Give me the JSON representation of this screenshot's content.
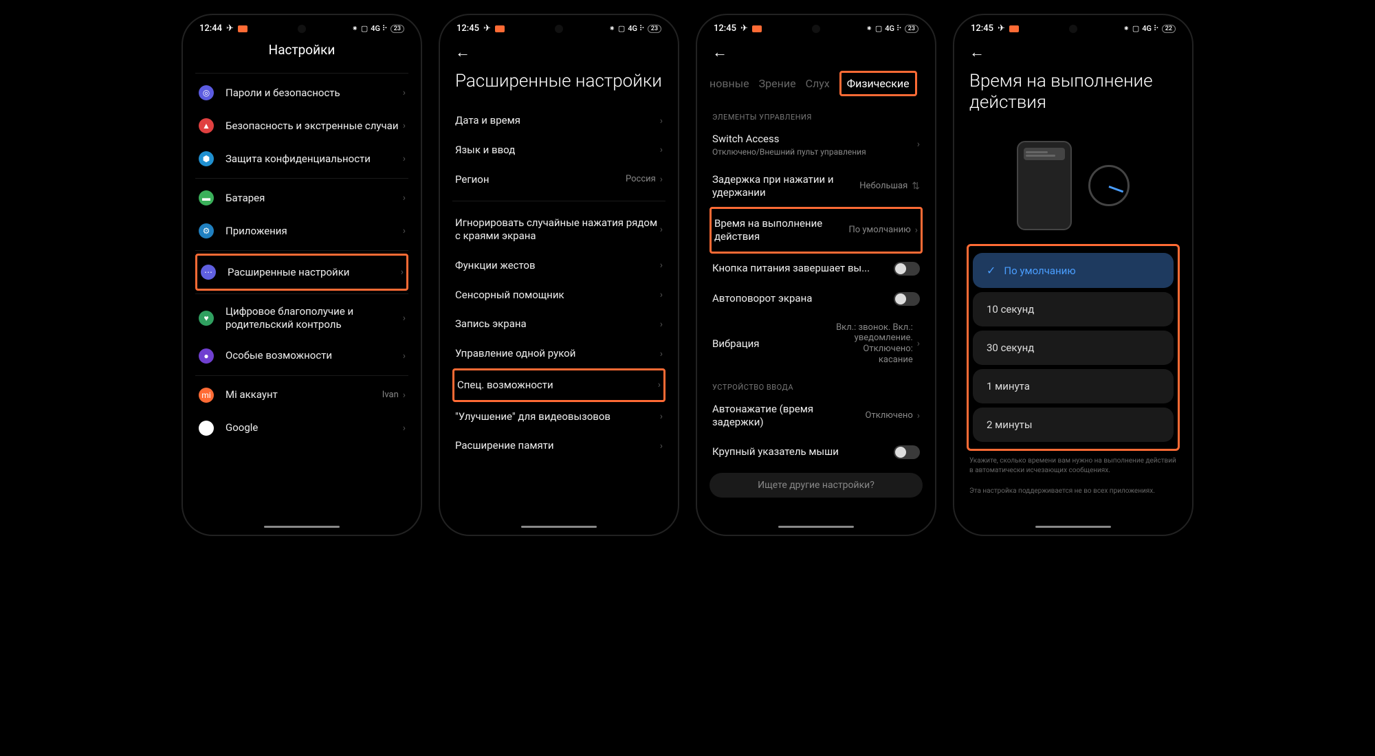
{
  "statusbar": {
    "time1": "12:44",
    "time234": "12:45",
    "battery1": "23",
    "battery234": "23",
    "battery4": "22",
    "icons_right": "⁕ 🔊 4G ⠇⠇"
  },
  "screen1": {
    "title": "Настройки",
    "rows": [
      {
        "icon": "fingerprint",
        "color": "#5b5be0",
        "label": "Пароли и безопасность"
      },
      {
        "icon": "alert",
        "color": "#e04040",
        "label": "Безопасность и экстренные случаи"
      },
      {
        "icon": "shield",
        "color": "#2090d0",
        "label": "Защита конфиденциальности"
      },
      {
        "icon": "battery",
        "color": "#3ab05a",
        "label": "Батарея"
      },
      {
        "icon": "apps",
        "color": "#2080c0",
        "label": "Приложения"
      },
      {
        "icon": "dots",
        "color": "#6060e0",
        "label": "Расширенные настройки",
        "hl": true
      },
      {
        "icon": "wellbeing",
        "color": "#30a060",
        "label": "Цифровое благополучие и родительский контроль"
      },
      {
        "icon": "a11y",
        "color": "#7040d0",
        "label": "Особые возможности"
      },
      {
        "icon": "mi",
        "color": "#ff6b35",
        "label": "Mi аккаунт",
        "value": "Ivan"
      },
      {
        "icon": "google",
        "color": "#fff",
        "label": "Google"
      }
    ]
  },
  "screen2": {
    "title": "Расширенные настройки",
    "rows": [
      {
        "label": "Дата и время"
      },
      {
        "label": "Язык и ввод"
      },
      {
        "label": "Регион",
        "value": "Россия"
      },
      {
        "divider": true
      },
      {
        "label": "Игнорировать случайные нажатия рядом с краями экрана"
      },
      {
        "label": "Функции жестов"
      },
      {
        "label": "Сенсорный помощник"
      },
      {
        "label": "Запись экрана"
      },
      {
        "label": "Управление одной рукой"
      },
      {
        "label": "Спец. возможности",
        "hl": true
      },
      {
        "label": "\"Улучшение\" для видеовызовов"
      },
      {
        "label": "Расширение памяти"
      }
    ]
  },
  "screen3": {
    "tabs": [
      "новные",
      "Зрение",
      "Слух",
      "Физические"
    ],
    "section1": "ЭЛЕМЕНТЫ УПРАВЛЕНИЯ",
    "rows1": [
      {
        "label": "Switch Access",
        "sub": "Отключено/Внешний пульт управления",
        "chev": true
      },
      {
        "label": "Задержка при нажатии и удержании",
        "value": "Небольшая",
        "sort": true
      },
      {
        "label": "Время на выполнение действия",
        "value": "По умолчанию",
        "hl": true,
        "chev": true
      },
      {
        "label": "Кнопка питания завершает вы...",
        "toggle": true
      },
      {
        "label": "Автоповорот экрана",
        "toggle": true
      },
      {
        "label": "Вибрация",
        "value": "Вкл.: звонок. Вкл.: уведомление. Отключено: касание",
        "chev": true
      }
    ],
    "section2": "УСТРОЙСТВО ВВОДА",
    "rows2": [
      {
        "label": "Автонажатие (время задержки)",
        "value": "Отключено",
        "chev": true
      },
      {
        "label": "Крупный указатель мыши",
        "toggle": true
      }
    ],
    "search": "Ищете другие настройки?"
  },
  "screen4": {
    "title": "Время на выполнение действия",
    "options": [
      "По умолчанию",
      "10 секунд",
      "30 секунд",
      "1 минута",
      "2 минуты"
    ],
    "foot1": "Укажите, сколько времени вам нужно на выполнение действий в автоматически исчезающих сообщениях.",
    "foot2": "Эта настройка поддерживается не во всех приложениях."
  }
}
